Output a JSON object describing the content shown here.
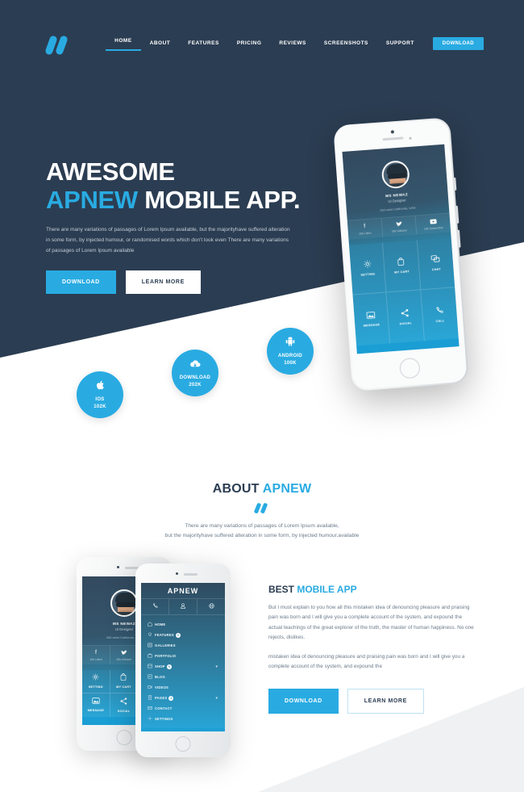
{
  "brand": {
    "name": "APNEW",
    "accent_color": "#29abe2",
    "dark_color": "#2b3d52",
    "logo_icon": "double-slash-logo-icon"
  },
  "nav": {
    "items": [
      {
        "label": "HOME",
        "active": true
      },
      {
        "label": "ABOUT",
        "active": false
      },
      {
        "label": "FEATURES",
        "active": false
      },
      {
        "label": "PRICING",
        "active": false
      },
      {
        "label": "REVIEWS",
        "active": false
      },
      {
        "label": "SCREENSHOTS",
        "active": false
      },
      {
        "label": "SUPPORT",
        "active": false
      }
    ],
    "download_label": "DOWNLOAD"
  },
  "hero": {
    "title_line1": "AWESOME",
    "title_accent": "APNEW",
    "title_rest": " MOBILE APP.",
    "paragraph": "There are many variations of passages of Lorem Ipsum available, but the majorityhave suffered alteration in some form, by injected humour, or randomised words which don't look even There are many variations of passages of Lorem Ipsum available",
    "primary_button": "DOWNLOAD",
    "secondary_button": "LEARN MORE",
    "badges": [
      {
        "icon": "apple-icon",
        "glyph": "",
        "label": "IOS",
        "count": "102K"
      },
      {
        "icon": "cloud-download-icon",
        "glyph": "☁",
        "label": "DOWNLOAD",
        "count": "202K"
      },
      {
        "icon": "android-icon",
        "glyph": "⚙",
        "label": "ANDROID",
        "count": "100K"
      }
    ]
  },
  "app_profile": {
    "name": "MS NEWAZ",
    "role": "UI Designer",
    "address": "284 west California, USA",
    "social": [
      {
        "icon": "facebook-icon",
        "glyph": "f",
        "text": "10k Liked"
      },
      {
        "icon": "twitter-icon",
        "glyph": "✉",
        "text": "30k follower"
      },
      {
        "icon": "youtube-icon",
        "glyph": "▶",
        "text": "10k Subscriber"
      }
    ],
    "grid": [
      {
        "icon": "gear-icon",
        "glyph": "⚙",
        "label": "SETTING"
      },
      {
        "icon": "shopping-bag-icon",
        "glyph": "□",
        "label": "MY CART"
      },
      {
        "icon": "chat-bubble-icon",
        "glyph": "⧉",
        "label": "CHAT"
      },
      {
        "icon": "image-message-icon",
        "glyph": "☒",
        "label": "MESSAGE"
      },
      {
        "icon": "share-icon",
        "glyph": "≺",
        "label": "SOCIAL"
      },
      {
        "icon": "phone-icon",
        "glyph": "✆",
        "label": "CALL"
      }
    ]
  },
  "about": {
    "title_main": "ABOUT ",
    "title_accent": "APNEW",
    "subtitle_line1": "There are many variations of passages of Lorem Ipsum available,",
    "subtitle_line2": "but the majorityhave suffered alteration in some form, by injected humour.available",
    "feature_title_main": "BEST ",
    "feature_title_accent": "MOBILE APP",
    "paragraph1": "But I must explain to you how all this mistaken idea of denouncing pleasure and praising pain was born and I will give you a complete account of the system, and expound the actual teachings of the great explorer of the truth, the master of human happiness. No one rejects, dislikes.",
    "paragraph2": "mistaken idea of denouncing pleasure and praising pain was born and I will give you a complete account of the system, and expound the",
    "primary_button": "DOWNLOAD",
    "secondary_button": "LEARN MORE"
  },
  "app_menu": {
    "logo_text": "APNEW",
    "top_icons": [
      {
        "icon": "phone-icon",
        "glyph": "✆"
      },
      {
        "icon": "user-avatar-icon",
        "glyph": "△"
      },
      {
        "icon": "globe-icon",
        "glyph": "●"
      }
    ],
    "items": [
      {
        "icon": "home-icon",
        "glyph": "⌂",
        "label": "HOME",
        "badge": "",
        "chevron": false
      },
      {
        "icon": "lightbulb-icon",
        "glyph": "◔",
        "label": "FEATURES",
        "badge": "3",
        "chevron": false
      },
      {
        "icon": "gallery-icon",
        "glyph": "▦",
        "label": "GALLERIES",
        "badge": "",
        "chevron": false
      },
      {
        "icon": "portfolio-icon",
        "glyph": "▤",
        "label": "PORTFOLIO",
        "badge": "",
        "chevron": false
      },
      {
        "icon": "shop-icon",
        "glyph": "▣",
        "label": "SHOP",
        "badge": "5",
        "chevron": true
      },
      {
        "icon": "blog-icon",
        "glyph": "▧",
        "label": "BLOG",
        "badge": "",
        "chevron": false
      },
      {
        "icon": "video-icon",
        "glyph": "▷",
        "label": "VIDEOS",
        "badge": "",
        "chevron": false
      },
      {
        "icon": "pages-icon",
        "glyph": "▥",
        "label": "PAGES",
        "badge": "2",
        "chevron": true
      },
      {
        "icon": "contact-icon",
        "glyph": "✉",
        "label": "CONTACT",
        "badge": "",
        "chevron": false
      },
      {
        "icon": "settings-icon",
        "glyph": "⚙",
        "label": "SETTINGS",
        "badge": "",
        "chevron": false
      }
    ]
  }
}
